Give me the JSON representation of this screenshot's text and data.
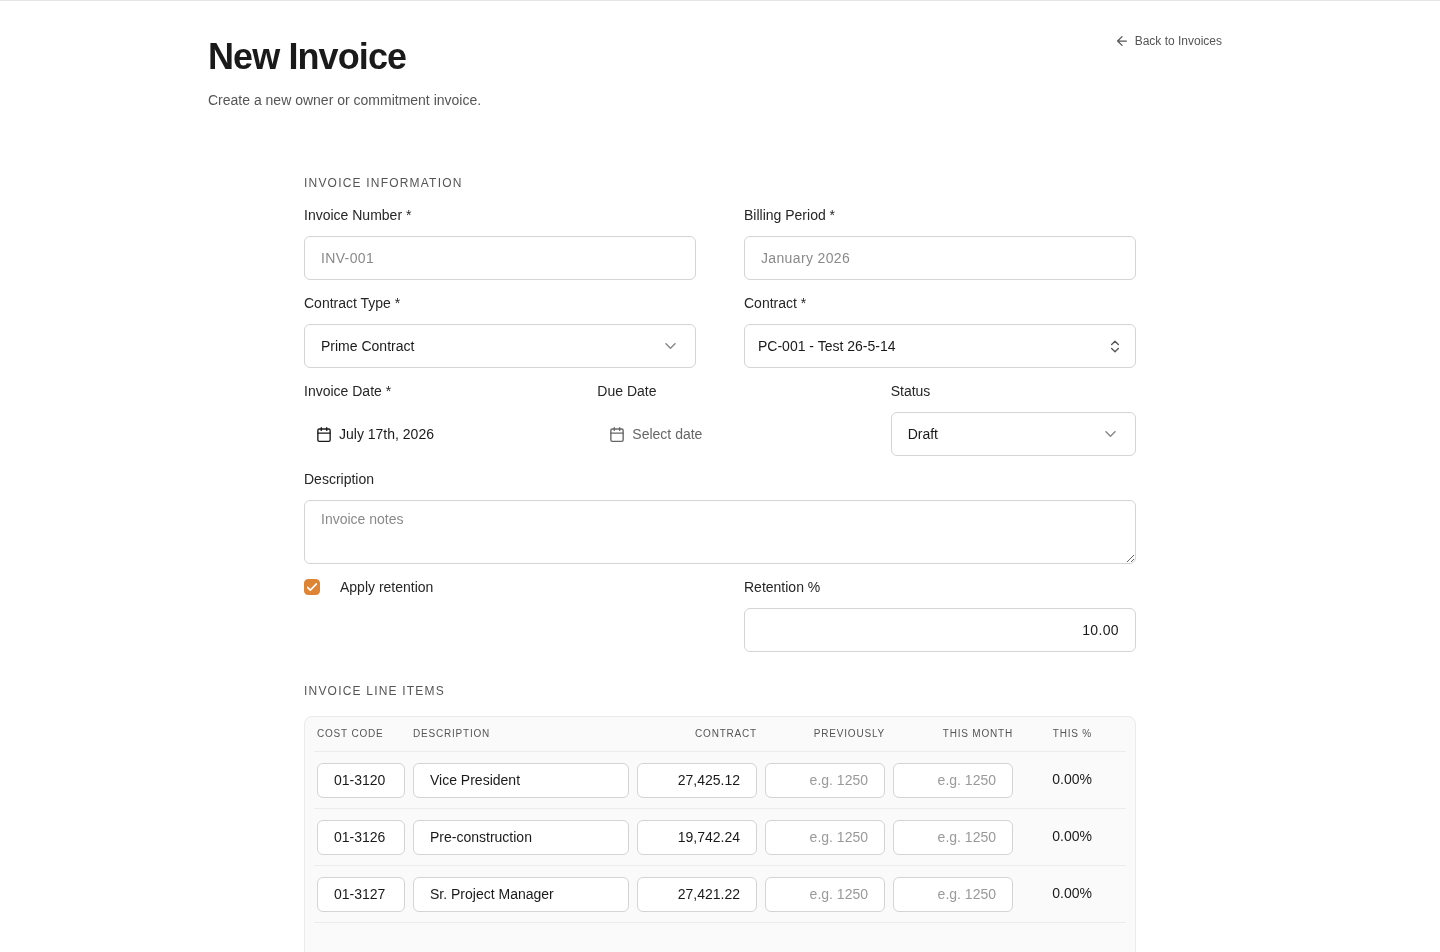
{
  "page_header": {
    "title": "New Invoice",
    "subtitle": "Create a new owner or commitment invoice.",
    "back_link": "Back to Invoices"
  },
  "invoice_information": {
    "heading": "INVOICE INFORMATION",
    "rows": [
      {
        "fields": [
          {
            "kind": "text",
            "label": "Invoice Number *",
            "placeholder": "INV-001"
          },
          {
            "kind": "text",
            "label": "Billing Period *",
            "placeholder": "January 2026"
          }
        ]
      },
      {
        "fields": [
          {
            "kind": "select",
            "label": "Contract Type *",
            "value": "Prime Contract"
          },
          {
            "kind": "combobox",
            "label": "Contract *",
            "value": "PC-001 - Test 26-5-14"
          }
        ]
      },
      {
        "fields": [
          {
            "kind": "date",
            "label": "Invoice Date *",
            "value": "July 17th, 2026"
          },
          {
            "kind": "date",
            "label": "Due Date",
            "placeholder": "Select date"
          },
          {
            "kind": "select",
            "label": "Status",
            "value": "Draft"
          }
        ]
      },
      {
        "fields": [
          {
            "kind": "textarea",
            "label": "Description",
            "placeholder": "Invoice notes"
          }
        ]
      },
      {
        "fields": [
          {
            "kind": "checkbox",
            "label": "Apply retention",
            "checked": true
          },
          {
            "kind": "number",
            "label": "Retention %",
            "value": "10.00"
          }
        ]
      }
    ]
  },
  "line_items": {
    "heading": "INVOICE LINE ITEMS",
    "columns": [
      "COST CODE",
      "DESCRIPTION",
      "CONTRACT",
      "PREVIOUSLY",
      "THIS MONTH",
      "THIS %"
    ],
    "rows": [
      {
        "cost_code": "01-3120",
        "description": "Vice President",
        "contract": "27,425.12",
        "previously": {
          "placeholder": "e.g. 1250"
        },
        "this_month": {
          "placeholder": "e.g. 1250"
        },
        "this_percent": "0.00%"
      },
      {
        "cost_code": "01-3126",
        "description": "Pre-construction",
        "contract": "19,742.24",
        "previously": {
          "placeholder": "e.g. 1250"
        },
        "this_month": {
          "placeholder": "e.g. 1250"
        },
        "this_percent": "0.00%"
      },
      {
        "cost_code": "01-3127",
        "description": "Sr. Project Manager",
        "contract": "27,421.22",
        "previously": {
          "placeholder": "e.g. 1250"
        },
        "this_month": {
          "placeholder": "e.g. 1250"
        },
        "this_percent": "0.00%"
      }
    ]
  }
}
